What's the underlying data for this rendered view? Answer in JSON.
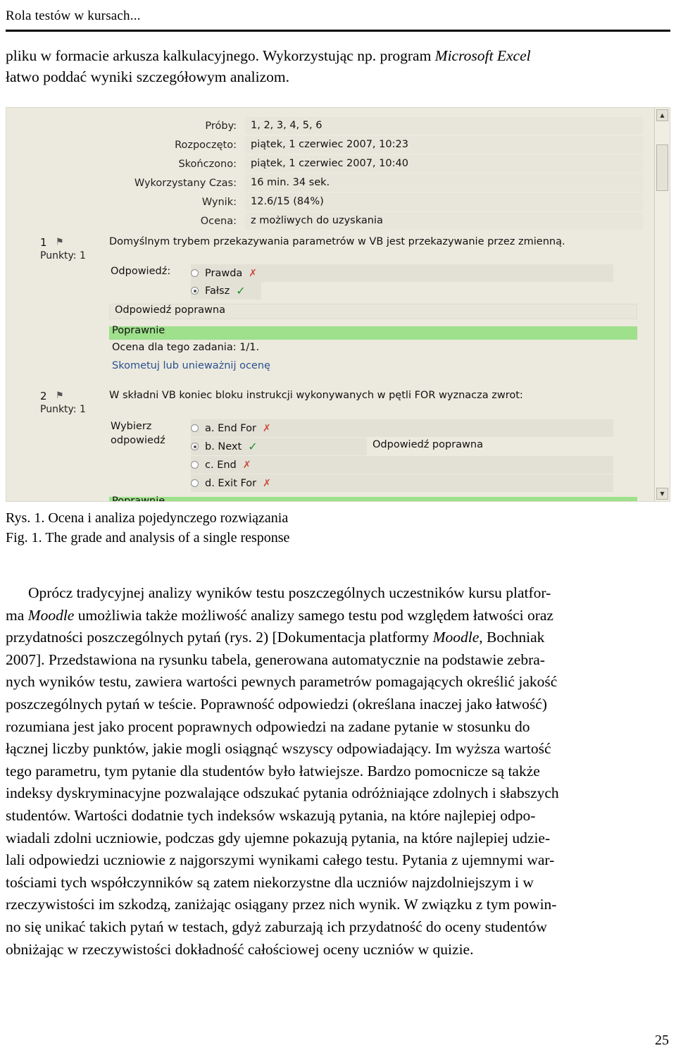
{
  "runninghead": "Rola testów w kursach...",
  "intro": {
    "line1_a": "pliku w formacie arkusza kalkulacyjnego. Wykorzystując np. program ",
    "line1_b": "Microsoft Excel",
    "line2": "łatwo poddać wyniki szczegółowym analizom."
  },
  "figure": {
    "summary": [
      {
        "label": "Próby:",
        "value": "1, 2, 3, 4, 5, 6"
      },
      {
        "label": "Rozpoczęto:",
        "value": "piątek, 1 czerwiec 2007, 10:23"
      },
      {
        "label": "Skończono:",
        "value": "piątek, 1 czerwiec 2007, 10:40"
      },
      {
        "label": "Wykorzystany Czas:",
        "value": "16 min. 34 sek."
      },
      {
        "label": "Wynik:",
        "value": "12.6/15 (84%)"
      },
      {
        "label": "Ocena:",
        "value": "z możliwych do uzyskania"
      }
    ],
    "question1": {
      "number": "1",
      "points": "Punkty: 1",
      "text": "Domyślnym trybem przekazywania parametrów w VB jest przekazywanie przez zmienną.",
      "answer_label": "Odpowiedź:",
      "options": [
        {
          "label": "Prawda",
          "selected": false,
          "mark": "x"
        },
        {
          "label": "Fałsz",
          "selected": true,
          "mark": "check"
        }
      ],
      "correct_label": "Odpowiedź poprawna",
      "feedback": "Poprawnie",
      "grade": "Ocena dla tego zadania: 1/1.",
      "comment_link": "Skometuj lub unieważnij ocenę"
    },
    "question2": {
      "number": "2",
      "points": "Punkty: 1",
      "text": "W składni VB koniec bloku instrukcji wykonywanych w pętli FOR wyznacza zwrot:",
      "answer_label_line1": "Wybierz",
      "answer_label_line2": "odpowiedź",
      "options": [
        {
          "label": "a. End For",
          "selected": false,
          "mark": "x"
        },
        {
          "label": "b. Next",
          "selected": true,
          "mark": "check"
        },
        {
          "label": "c. End",
          "selected": false,
          "mark": "x"
        },
        {
          "label": "d. Exit For",
          "selected": false,
          "mark": "x"
        }
      ],
      "correct_label": "Odpowiedź poprawna",
      "feedback": "Poprawnie"
    },
    "scrollbar": {
      "up": "▲",
      "down": "▼"
    }
  },
  "captions": {
    "pl": "Rys. 1. Ocena i analiza pojedynczego rozwiązania",
    "en": "Fig. 1. The grade and analysis of a single response"
  },
  "paragraph": {
    "l1_a": "Oprócz tradycyjnej analizy wyników testu poszczególnych uczestników kursu platfor-",
    "l2_a": "ma ",
    "l2_i": "Moodle",
    "l2_b": " umożliwia także możliwość analizy samego testu pod względem łatwości oraz",
    "l3_a": "przydatności poszczególnych pytań (rys. 2) [Dokumentacja platformy ",
    "l3_i": "Moodle",
    "l3_b": ", Bochniak",
    "l4": "2007]. Przedstawiona na rysunku tabela, generowana automatycznie na podstawie zebra-",
    "l5": "nych wyników testu, zawiera wartości pewnych parametrów pomagających określić jakość",
    "l6": "poszczególnych pytań w teście. Poprawność odpowiedzi (określana inaczej jako łatwość)",
    "l7": "rozumiana jest jako procent poprawnych odpowiedzi na zadane pytanie w stosunku do",
    "l8": "łącznej liczby punktów, jakie mogli osiągnąć wszyscy odpowiadający. Im wyższa wartość",
    "l9": "tego parametru, tym pytanie dla studentów było łatwiejsze. Bardzo pomocnicze są także",
    "l10": "indeksy dyskryminacyjne pozwalające odszukać pytania odróżniające zdolnych i słabszych",
    "l11": "studentów. Wartości dodatnie tych indeksów wskazują pytania, na które najlepiej odpo-",
    "l12": "wiadali zdolni uczniowie, podczas gdy ujemne pokazują pytania, na które najlepiej udzie-",
    "l13": "lali odpowiedzi uczniowie z najgorszymi wynikami całego testu. Pytania z ujemnymi war-",
    "l14": "tościami tych współczynników są zatem niekorzystne dla uczniów najzdolniejszym i w",
    "l15": "rzeczywistości im szkodzą, zaniżając osiągany przez nich wynik. W związku z tym powin-",
    "l16": "no się unikać takich pytań w testach, gdyż zaburzają ich przydatność do oceny studentów",
    "l17": "obniżając w rzeczywistości dokładność całościowej oceny uczniów w quizie."
  },
  "folio": "25"
}
